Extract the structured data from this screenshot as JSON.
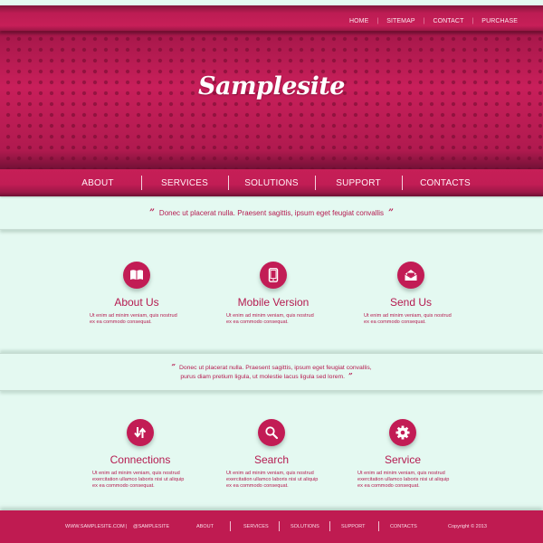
{
  "site": {
    "logo": "Samplesite"
  },
  "top_nav": [
    "HOME",
    "SITEMAP",
    "CONTACT",
    "PURCHASE"
  ],
  "main_nav": [
    "ABOUT",
    "SERVICES",
    "SOLUTIONS",
    "SUPPORT",
    "CONTACTS"
  ],
  "quote1": {
    "open": "”",
    "text": "Donec ut placerat nulla. Praesent sagittis, ipsum eget feugiat convallis",
    "close": "”"
  },
  "features_row1": [
    {
      "icon": "book-icon",
      "title": "About Us",
      "desc": [
        "Ut enim ad minim veniam, quis nostrud",
        "ex ea commodo consequat."
      ]
    },
    {
      "icon": "mobile-icon",
      "title": "Mobile Version",
      "desc": [
        "Ut enim ad minim veniam, quis nostrud",
        "ex ea commodo consequat."
      ]
    },
    {
      "icon": "envelope-icon",
      "title": "Send Us",
      "desc": [
        "Ut enim ad minim veniam, quis nostrud",
        "ex ea commodo consequat."
      ]
    }
  ],
  "quote2": {
    "open": "”",
    "line1": "Donec ut placerat nulla. Praesent sagittis, ipsum eget feugiat convallis,",
    "line2": "purus diam pretium ligula, ut molestie lacus ligula sed lorem.",
    "close": "”"
  },
  "features_row2": [
    {
      "icon": "arrows-exchange-icon",
      "title": "Connections",
      "desc": [
        "Ut enim ad minim veniam, quis nostrud",
        "exercitation ullamco laboris nisi ut aliquip",
        "ex ea commodo consequat."
      ]
    },
    {
      "icon": "search-icon",
      "title": "Search",
      "desc": [
        "Ut enim ad minim veniam, quis nostrud",
        "exercitation ullamco laboris nisi ut aliquip",
        "ex ea commodo consequat."
      ]
    },
    {
      "icon": "gear-icon",
      "title": "Service",
      "desc": [
        "Ut enim ad minim veniam, quis nostrud",
        "exercitation ullamco laboris nisi ut aliquip",
        "ex ea commodo consequat."
      ]
    }
  ],
  "footer": {
    "website": "WWW.SAMPLESITE.COM",
    "separator": "|",
    "handle": "@SAMPLESITE",
    "nav": [
      "ABOUT",
      "SERVICES",
      "SOLUTIONS",
      "SUPPORT",
      "CONTACTS"
    ],
    "copyright": "Copyright © 2013"
  },
  "colors": {
    "brand": "#c21c55",
    "background": "#e4f9f1",
    "text_accent": "#b51b50"
  }
}
